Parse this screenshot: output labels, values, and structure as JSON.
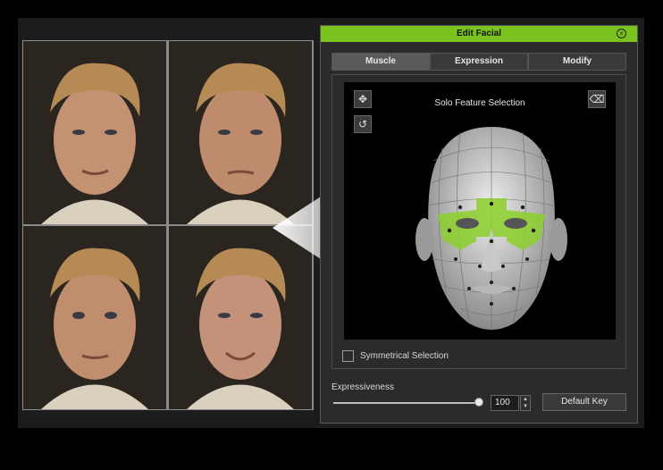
{
  "window": {
    "title": "Edit Facial"
  },
  "tabs": [
    {
      "label": "Muscle",
      "active": true
    },
    {
      "label": "Expression",
      "active": false
    },
    {
      "label": "Modify",
      "active": false
    }
  ],
  "viewport": {
    "heading": "Solo Feature Selection"
  },
  "symmetrical": {
    "label": "Symmetrical Selection",
    "checked": false
  },
  "expressiveness": {
    "label": "Expressiveness",
    "value": "100",
    "level": 1.0
  },
  "buttons": {
    "default_key": "Default Key"
  },
  "colors": {
    "accent": "#7cc21f",
    "panel": "#2b2b2b",
    "viewport": "#000000"
  },
  "icons": {
    "pick": "pick-icon",
    "reset": "reset-icon",
    "eraser": "eraser-icon",
    "close": "close-icon"
  }
}
